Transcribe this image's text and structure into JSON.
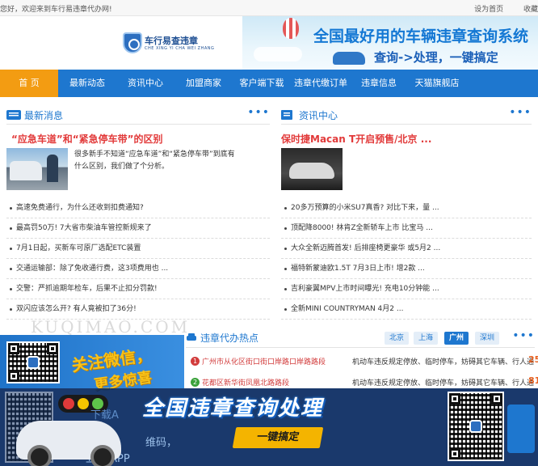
{
  "topbar": {
    "welcome": "您好，欢迎来到车行易违章代办网!",
    "set_home": "设为首页",
    "favorite": "收藏"
  },
  "logo": {
    "name": "车行易查违章",
    "pinyin": "CHE XING YI CHA WEI ZHANG"
  },
  "banner": {
    "line1": "全国最好用的车辆违章查询系统",
    "line2": "查询->处理，一键搞定"
  },
  "nav": [
    {
      "label": "首 页",
      "active": true
    },
    {
      "label": "最新动态"
    },
    {
      "label": "资讯中心"
    },
    {
      "label": "加盟商家"
    },
    {
      "label": "客户端下载"
    },
    {
      "label": "违章代缴订单"
    },
    {
      "label": "违章信息"
    },
    {
      "label": "天猫旗舰店"
    }
  ],
  "latest": {
    "title": "最新消息",
    "more": "•••",
    "headline": "“应急车道”和“紧急停车带”的区别",
    "desc": "很多新手不知道“应急车道”和“紧急停车带”到底有什么区别，我们做了个分析。",
    "items": [
      "高速免费通行，为什么还收到扣费通知?",
      "最高罚50万! 7大省市柴油车管控新规来了",
      "7月1日起，买新车可原厂选配ETC装置",
      "交通运输部：除了免收通行费，这3项费用也 ...",
      "交警：严抓逾期年检车，后果不止扣分罚款!",
      "双闪应该怎么开? 有人竟被扣了36分!"
    ]
  },
  "news": {
    "title": "资讯中心",
    "more": "•••",
    "headline": "保时捷Macan T开启预售/北京 ...",
    "items": [
      "20多万预算的小米SU7真香? 对比下来，量 ...",
      "顶配降8000! 林肯Z全新轿车上市 比宝马 ...",
      "大众全新迈腾首发! 后排座椅更豪华 或5月2 ...",
      "福特新蒙迪欧1.5T 7月3日上市! 增2款 ...",
      "吉利豪翼MPV上市时间曝光! 充电10分钟能 ...",
      "全新MINI COUNTRYMAN 4月2 ..."
    ]
  },
  "watermark": "KUQIMAO.COM",
  "hot": {
    "title": "违章代办热点",
    "more": "•••",
    "tabs": [
      {
        "label": "北京"
      },
      {
        "label": "上海"
      },
      {
        "label": "广州",
        "active": true
      },
      {
        "label": "深圳"
      }
    ],
    "rows": [
      {
        "rank": "1",
        "location": "广州市从化区街口街口岸路口岸路路段",
        "behavior": "机动车违反规定停放、临时停车，妨碍其它车辆、行人通",
        "count": "25"
      },
      {
        "rank": "2",
        "location": "花都区新华街凤凰北路路段",
        "behavior": "机动车违反规定停放、临时停车，妨碍其它车辆、行人通",
        "count": "81"
      }
    ]
  },
  "wechat": {
    "line1": "关注微信，",
    "line2": "更多惊喜"
  },
  "bottom_banner": {
    "slogan": "全国违章查询处理",
    "button": "一键搞定",
    "left_text_1": "下载A",
    "left_text_2": "维码，",
    "left_text_3": "立 载APP"
  },
  "colors": {
    "nav": "#1e77cf",
    "active": "#f39c12",
    "headline": "#e23a3a"
  }
}
